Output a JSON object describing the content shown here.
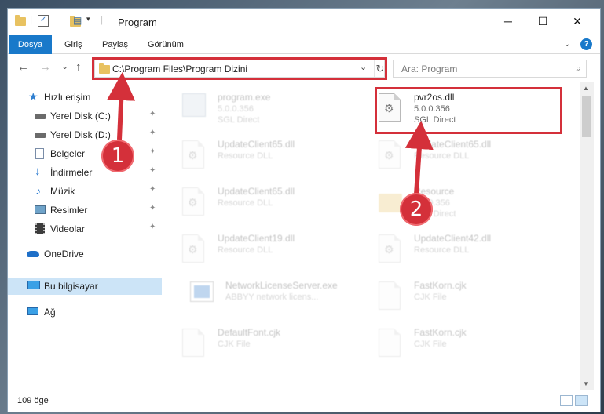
{
  "titlebar": {
    "title": "Program",
    "minimize_icon": "─",
    "maximize_icon": "☐",
    "close_icon": "✕"
  },
  "ribbon": {
    "tabs": [
      "Dosya",
      "Giriş",
      "Paylaş",
      "Görünüm"
    ],
    "help_label": "?"
  },
  "nav": {
    "back": "←",
    "forward": "→",
    "recent": "⌄",
    "up": "↑",
    "address": "C:\\Program Files\\Program Dizini",
    "chevron": "⌄",
    "refresh": "↻",
    "search_placeholder": "Ara: Program",
    "search_icon": "⌕"
  },
  "sidebar": {
    "items": [
      {
        "label": "Hızlı erişim",
        "icon": "star-icon",
        "pinned": false
      },
      {
        "label": "Yerel Disk (C:)",
        "icon": "drive-icon",
        "pinned": true
      },
      {
        "label": "Yerel Disk (D:)",
        "icon": "drive-icon",
        "pinned": true
      },
      {
        "label": "Belgeler",
        "icon": "documents-icon",
        "pinned": true
      },
      {
        "label": "İndirmeler",
        "icon": "download-icon",
        "pinned": true
      },
      {
        "label": "Müzik",
        "icon": "music-icon",
        "pinned": true
      },
      {
        "label": "Resimler",
        "icon": "pictures-icon",
        "pinned": true
      },
      {
        "label": "Videolar",
        "icon": "video-icon",
        "pinned": true
      },
      {
        "label": "OneDrive",
        "icon": "cloud-icon",
        "pinned": false
      },
      {
        "label": "Bu bilgisayar",
        "icon": "computer-icon",
        "pinned": false
      },
      {
        "label": "Ağ",
        "icon": "network-icon",
        "pinned": false
      }
    ],
    "pin_glyph": "📌"
  },
  "files": [
    {
      "name": "program.exe",
      "line1": "5.0.0.356",
      "line2": "SGL Direct",
      "icon": "exe-icon"
    },
    {
      "name": "pvr2os.dll",
      "line1": "5.0.0.356",
      "line2": "SGL Direct",
      "icon": "dll-icon"
    },
    {
      "name": "UpdateClient65.dll",
      "line1": "Resource DLL",
      "line2": "",
      "icon": "dll-icon"
    },
    {
      "name": "UpdateClient65.dll",
      "line1": "Resource DLL",
      "line2": "",
      "icon": "dll-icon"
    },
    {
      "name": "UpdateClient65.dll",
      "line1": "Resource DLL",
      "line2": "",
      "icon": "dll-icon"
    },
    {
      "name": "Resource",
      "line1": "5.0.0.356",
      "line2": "SGL Direct",
      "icon": "folder-icon"
    },
    {
      "name": "UpdateClient19.dll",
      "line1": "Resource DLL",
      "line2": "",
      "icon": "dll-icon"
    },
    {
      "name": "UpdateClient42.dll",
      "line1": "Resource DLL",
      "line2": "",
      "icon": "dll-icon"
    },
    {
      "name": "NetworkLicenseServer.exe",
      "line1": "ABBYY network licens...",
      "line2": "",
      "icon": "exe-icon"
    },
    {
      "name": "FastKorn.cjk",
      "line1": "CJK File",
      "line2": "",
      "icon": "file-icon"
    },
    {
      "name": "DefaultFont.cjk",
      "line1": "CJK File",
      "line2": "",
      "icon": "file-icon"
    },
    {
      "name": "FastKorn.cjk",
      "line1": "CJK File",
      "line2": "",
      "icon": "file-icon"
    }
  ],
  "status": {
    "count": "109 öge"
  },
  "annotations": {
    "step1": "1",
    "step2": "2",
    "color": "#d4303a"
  }
}
